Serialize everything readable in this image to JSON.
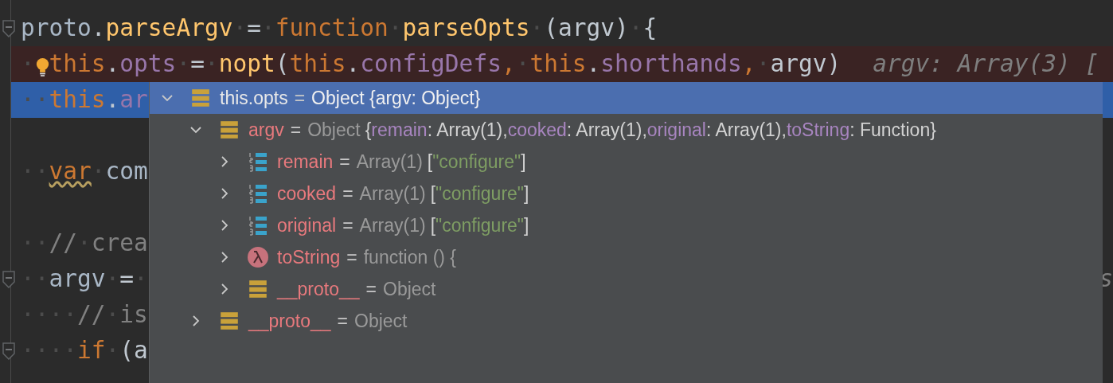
{
  "editor": {
    "lines": [
      {
        "fold": true,
        "breakpoint": false,
        "selected": false,
        "tokens": [
          {
            "kind": "ident",
            "text": "proto"
          },
          {
            "kind": "punct",
            "text": "."
          },
          {
            "kind": "func",
            "text": "parseArgv"
          },
          {
            "kind": "ws",
            "text": "·"
          },
          {
            "kind": "punct",
            "text": "="
          },
          {
            "kind": "ws",
            "text": "·"
          },
          {
            "kind": "keyword",
            "text": "function"
          },
          {
            "kind": "ws",
            "text": "·"
          },
          {
            "kind": "func",
            "text": "parseOpts"
          },
          {
            "kind": "ws",
            "text": "·"
          },
          {
            "kind": "punct",
            "text": "(argv)"
          },
          {
            "kind": "ws",
            "text": "·"
          },
          {
            "kind": "punct",
            "text": "{"
          }
        ]
      },
      {
        "fold": false,
        "breakpoint": true,
        "selected": false,
        "bulb": true,
        "tokens": [
          {
            "kind": "ws",
            "text": "·"
          },
          {
            "kind": "this",
            "text": "this"
          },
          {
            "kind": "punct",
            "text": "."
          },
          {
            "kind": "field",
            "text": "opts"
          },
          {
            "kind": "ws",
            "text": "·"
          },
          {
            "kind": "punct",
            "text": "="
          },
          {
            "kind": "ws",
            "text": "·"
          },
          {
            "kind": "func",
            "text": "nopt"
          },
          {
            "kind": "punct",
            "text": "("
          },
          {
            "kind": "this",
            "text": "this"
          },
          {
            "kind": "punct",
            "text": "."
          },
          {
            "kind": "field",
            "text": "configDefs"
          },
          {
            "kind": "keyword",
            "text": ","
          },
          {
            "kind": "ws",
            "text": "·"
          },
          {
            "kind": "this",
            "text": "this"
          },
          {
            "kind": "punct",
            "text": "."
          },
          {
            "kind": "field",
            "text": "shorthands"
          },
          {
            "kind": "keyword",
            "text": ","
          },
          {
            "kind": "ws",
            "text": "·"
          },
          {
            "kind": "punct",
            "text": "argv)"
          }
        ],
        "hint": "argv: Array(3) [",
        "hint_at_edge": false
      },
      {
        "fold": false,
        "breakpoint": false,
        "selected": true,
        "tokens": [
          {
            "kind": "ws",
            "text": "··"
          },
          {
            "kind": "this",
            "text": "this"
          },
          {
            "kind": "punct",
            "text": "."
          },
          {
            "kind": "field",
            "text": "ar"
          }
        ]
      },
      {
        "fold": false,
        "breakpoint": false,
        "selected": false
      },
      {
        "fold": false,
        "breakpoint": false,
        "selected": false,
        "tokens": [
          {
            "kind": "ws",
            "text": "··"
          },
          {
            "kind": "keyword-warn",
            "text": "var"
          },
          {
            "kind": "ws",
            "text": "·"
          },
          {
            "kind": "ident",
            "text": "com"
          }
        ]
      },
      {
        "fold": false,
        "breakpoint": false,
        "selected": false
      },
      {
        "fold": false,
        "breakpoint": false,
        "selected": false,
        "tokens": [
          {
            "kind": "ws",
            "text": "··"
          },
          {
            "kind": "comment",
            "text": "//"
          },
          {
            "kind": "ws",
            "text": "·"
          },
          {
            "kind": "comment",
            "text": "crea"
          }
        ]
      },
      {
        "fold": true,
        "breakpoint": false,
        "selected": false,
        "tokens": [
          {
            "kind": "ws",
            "text": "··"
          },
          {
            "kind": "ident",
            "text": "argv"
          },
          {
            "kind": "ws",
            "text": "·"
          },
          {
            "kind": "punct",
            "text": "="
          },
          {
            "kind": "ws",
            "text": "·"
          }
        ],
        "hint": "s",
        "hint_at_edge": true
      },
      {
        "fold": false,
        "breakpoint": false,
        "selected": false,
        "tokens": [
          {
            "kind": "ws",
            "text": "····"
          },
          {
            "kind": "comment",
            "text": "//"
          },
          {
            "kind": "ws",
            "text": "·"
          },
          {
            "kind": "comment",
            "text": "is"
          }
        ]
      },
      {
        "fold": true,
        "breakpoint": false,
        "selected": false,
        "tokens": [
          {
            "kind": "ws",
            "text": "····"
          },
          {
            "kind": "keyword",
            "text": "if"
          },
          {
            "kind": "ws",
            "text": "·"
          },
          {
            "kind": "punct",
            "text": "(a"
          }
        ]
      }
    ]
  },
  "popup": {
    "nodes": [
      {
        "kind": "object",
        "name": "this.opts",
        "equals": "=",
        "expanded": true,
        "selected": true,
        "value": [
          {
            "kind": "plain",
            "text": "Object {argv: Object}"
          }
        ],
        "children": [
          {
            "kind": "object",
            "name": "argv",
            "equals": "=",
            "expanded": true,
            "selected": false,
            "value": [
              {
                "kind": "type",
                "text": "Object"
              },
              {
                "kind": "plain",
                "text": "{"
              },
              {
                "kind": "key",
                "text": "remain"
              },
              {
                "kind": "plain",
                "text": ": Array(1),"
              },
              {
                "kind": "key",
                "text": "cooked"
              },
              {
                "kind": "plain",
                "text": ": Array(1),"
              },
              {
                "kind": "key",
                "text": "original"
              },
              {
                "kind": "plain",
                "text": ": Array(1),"
              },
              {
                "kind": "key",
                "text": "toString"
              },
              {
                "kind": "plain",
                "text": ": Function}"
              }
            ],
            "children": [
              {
                "kind": "array",
                "name": "remain",
                "equals": "=",
                "expanded": false,
                "selected": false,
                "value": [
                  {
                    "kind": "type",
                    "text": "Array(1)"
                  },
                  {
                    "kind": "plain",
                    "text": "["
                  },
                  {
                    "kind": "string",
                    "text": "\"configure\""
                  },
                  {
                    "kind": "plain",
                    "text": "]"
                  }
                ]
              },
              {
                "kind": "array",
                "name": "cooked",
                "equals": "=",
                "expanded": false,
                "selected": false,
                "value": [
                  {
                    "kind": "type",
                    "text": "Array(1)"
                  },
                  {
                    "kind": "plain",
                    "text": "["
                  },
                  {
                    "kind": "string",
                    "text": "\"configure\""
                  },
                  {
                    "kind": "plain",
                    "text": "]"
                  }
                ]
              },
              {
                "kind": "array",
                "name": "original",
                "equals": "=",
                "expanded": false,
                "selected": false,
                "value": [
                  {
                    "kind": "type",
                    "text": "Array(1)"
                  },
                  {
                    "kind": "plain",
                    "text": "["
                  },
                  {
                    "kind": "string",
                    "text": "\"configure\""
                  },
                  {
                    "kind": "plain",
                    "text": "]"
                  }
                ]
              },
              {
                "kind": "function",
                "name": "toString",
                "equals": "=",
                "expanded": false,
                "selected": false,
                "value": [
                  {
                    "kind": "type",
                    "text": "function () {"
                  }
                ]
              },
              {
                "kind": "object",
                "name": "__proto__",
                "equals": "=",
                "expanded": false,
                "selected": false,
                "value": [
                  {
                    "kind": "type",
                    "text": "Object"
                  }
                ]
              }
            ]
          },
          {
            "kind": "object",
            "name": "__proto__",
            "equals": "=",
            "expanded": false,
            "selected": false,
            "value": [
              {
                "kind": "type",
                "text": "Object"
              }
            ]
          }
        ]
      }
    ]
  }
}
